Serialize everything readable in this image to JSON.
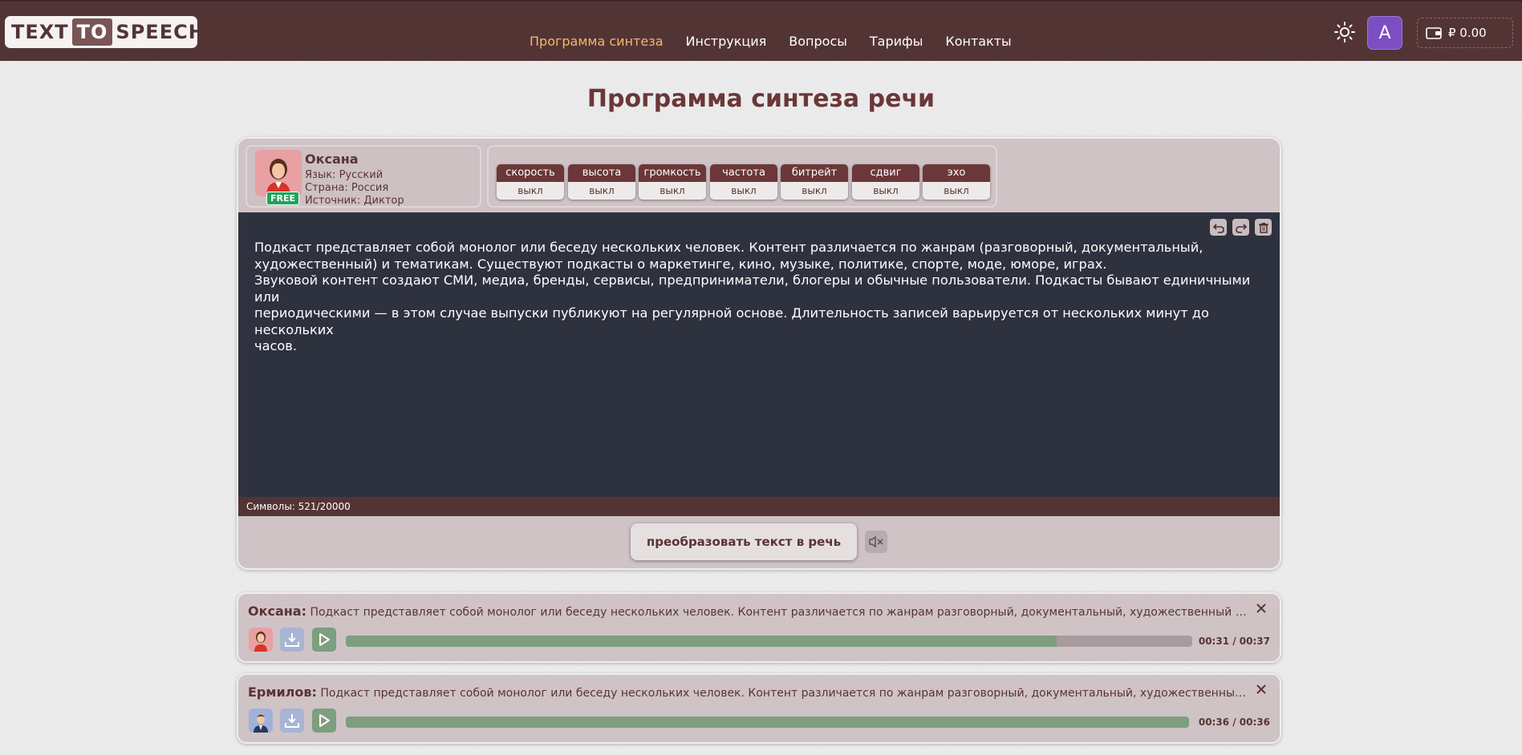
{
  "logo": {
    "part1": "TEXT",
    "part2": "TO",
    "part3": "SPEECH"
  },
  "nav": [
    {
      "label": "Программа синтеза",
      "active": true
    },
    {
      "label": "Инструкция",
      "active": false
    },
    {
      "label": "Вопросы",
      "active": false
    },
    {
      "label": "Тарифы",
      "active": false
    },
    {
      "label": "Контакты",
      "active": false
    }
  ],
  "user": {
    "avatar_letter": "A",
    "balance": "₽ 0.00"
  },
  "page_title": "Программа синтеза речи",
  "voice": {
    "name": "Оксана",
    "language": "Язык: Русский",
    "country": "Страна: Россия",
    "source": "Источник: Диктор",
    "badge": "FREE"
  },
  "params": [
    {
      "name": "скорость",
      "value": "выкл"
    },
    {
      "name": "высота",
      "value": "выкл"
    },
    {
      "name": "громкость",
      "value": "выкл"
    },
    {
      "name": "частота",
      "value": "выкл"
    },
    {
      "name": "битрейт",
      "value": "выкл"
    },
    {
      "name": "сдвиг",
      "value": "выкл"
    },
    {
      "name": "эхо",
      "value": "выкл"
    }
  ],
  "editor": {
    "lines": [
      "Подкаст представляет собой монолог или беседу нескольких человек. Контент различается по жанрам (разговорный, документальный,",
      "художественный) и тематикам. Существуют подкасты о маркетинге, кино, музыке, политике, спорте, моде, юморе, играх.",
      "Звуковой контент создают СМИ, медиа, бренды, сервисы, предприниматели, блогеры и обычные пользователи. Подкасты бывают единичными или",
      "периодическими — в этом случае выпуски публикуют на регулярной основе. Длительность записей варьируется от нескольких минут до нескольких",
      "часов."
    ],
    "counter": "Символы: 521/20000"
  },
  "convert_button": "преобразовать текст в речь",
  "tracks": [
    {
      "voice": "Оксана:",
      "text": "Подкаст представляет собой монолог или беседу нескольких человек. Контент различается по жанрам разговорный, документальный, художественный и тематик...",
      "time": "00:31 / 00:37",
      "progress": 0.84
    },
    {
      "voice": "Ермилов:",
      "text": "Подкаст представляет собой монолог или беседу нескольких человек. Контент различается по жанрам разговорный, документальный, художественный и темат...",
      "time": "00:36 / 00:36",
      "progress": 1.0
    }
  ],
  "colors": {
    "brand": "#533435",
    "accent": "#f2b86d",
    "editor_bg": "#2e323e"
  }
}
